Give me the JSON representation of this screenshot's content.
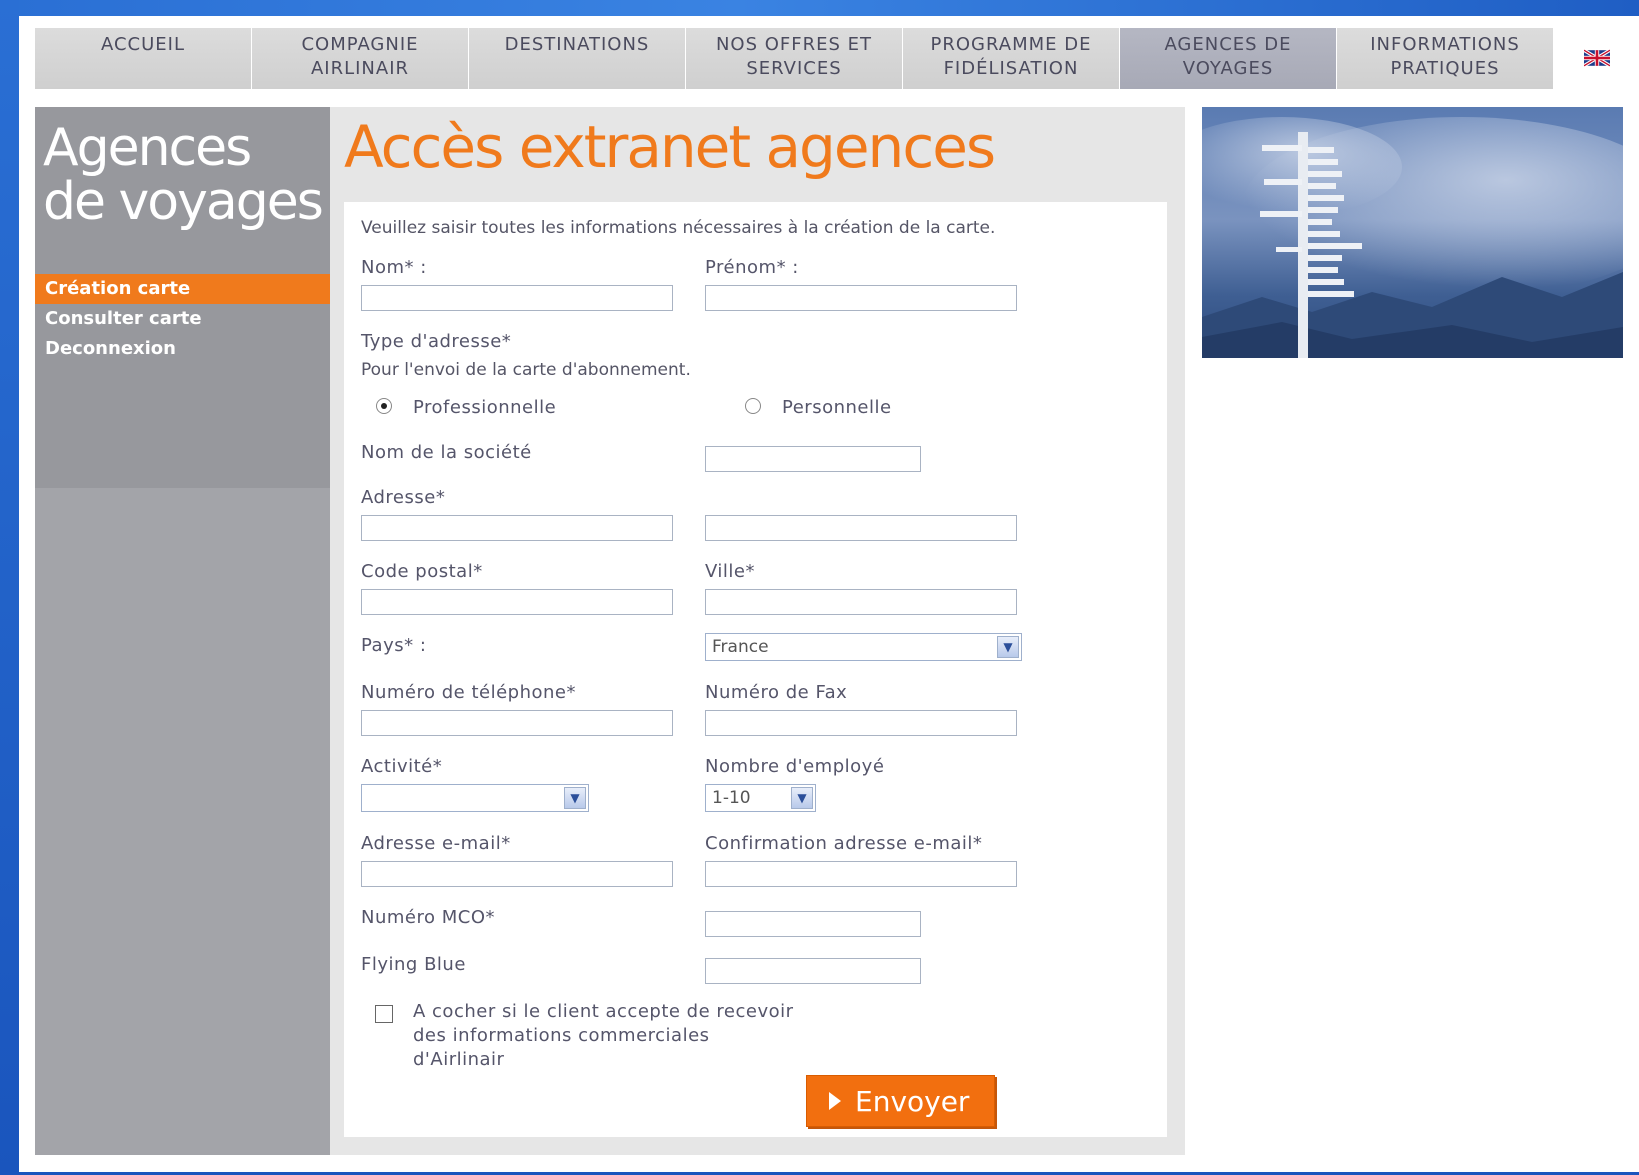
{
  "nav": {
    "items": [
      {
        "label": "ACCUEIL"
      },
      {
        "label": "COMPAGNIE\nAIRLINAIR"
      },
      {
        "label": "DESTINATIONS"
      },
      {
        "label": "NOS OFFRES ET\nSERVICES"
      },
      {
        "label": "PROGRAMME DE\nFIDÉLISATION"
      },
      {
        "label": "AGENCES DE\nVOYAGES"
      },
      {
        "label": "INFORMATIONS\nPRATIQUES"
      }
    ],
    "active_index": 5,
    "language_icon": "uk-flag-icon"
  },
  "sidebar": {
    "title_line1": "Agences",
    "title_line2": "de voyages",
    "links": [
      {
        "label": "Création carte",
        "active": true
      },
      {
        "label": "Consulter carte",
        "active": false
      },
      {
        "label": "Deconnexion",
        "active": false
      }
    ]
  },
  "main": {
    "title": "Accès extranet agences",
    "intro": "Veuillez saisir toutes les informations nécessaires à la création de la carte.",
    "fields": {
      "nom": "Nom* :",
      "prenom": "Prénom* :",
      "type_adresse": "Type d'adresse*",
      "type_adresse_note": "Pour l'envoi de la carte d'abonnement.",
      "radio_pro": "Professionnelle",
      "radio_perso": "Personnelle",
      "societe": "Nom de la société",
      "adresse": "Adresse*",
      "code_postal": "Code postal*",
      "ville": "Ville*",
      "pays": "Pays* :",
      "pays_value": "France",
      "telephone": "Numéro de téléphone*",
      "fax": "Numéro de Fax",
      "activite": "Activité*",
      "activite_value": "",
      "employes": "Nombre d'employé",
      "employes_value": "1-10",
      "email": "Adresse e-mail*",
      "email_confirm": "Confirmation adresse e-mail*",
      "mco": "Numéro MCO*",
      "flying_blue": "Flying Blue",
      "optin_line1": "A cocher si le client accepte de recevoir",
      "optin_line2": "des informations commerciales",
      "optin_line3": "d'Airlinair"
    },
    "address_type_selected": "Professionnelle",
    "optin_checked": false,
    "submit_label": "Envoyer"
  },
  "colors": {
    "accent": "#f07a1c",
    "sidebar": "#a3a4a9",
    "nav": "#d3d3d3",
    "nav_active": "#adafbb"
  }
}
